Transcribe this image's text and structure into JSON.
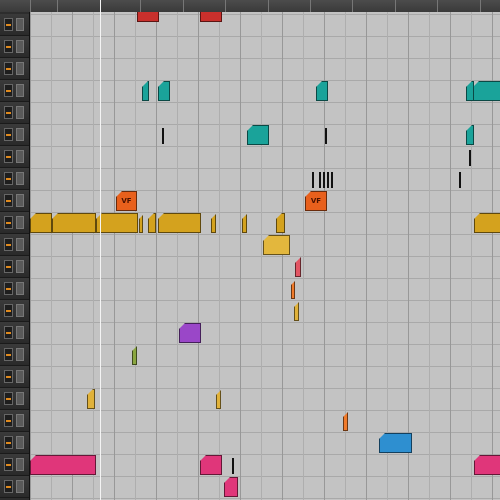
{
  "ruler": {
    "bar_labels": [
      "",
      "",
      "",
      "",
      "",
      "",
      "",
      "",
      "",
      "",
      ""
    ]
  },
  "tracks": {
    "count": 22
  },
  "colors": {
    "red": "#c9302c",
    "teal": "#1aa39a",
    "orange": "#e8601c",
    "gold": "#d4a21e",
    "gold_light": "#e3b73d",
    "pink_red": "#e25563",
    "orange_small": "#f07a2a",
    "gold_small": "#e1b23a",
    "purple": "#9a47c8",
    "olive": "#8aa640",
    "blue": "#2e8fd0",
    "magenta": "#e0367a",
    "black_thin": "#111111"
  },
  "clips": {
    "vf_label_1": "VF",
    "vf_label_2": "VF"
  }
}
